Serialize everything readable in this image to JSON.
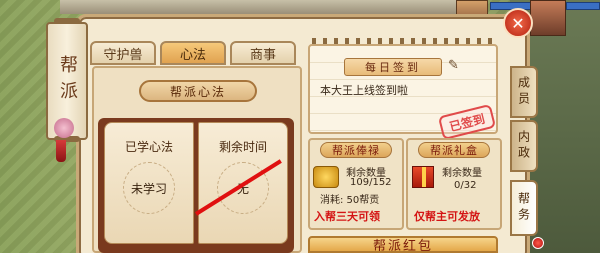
{
  "banner": {
    "label": "帮派"
  },
  "close": {
    "label": "✕"
  },
  "tabs": [
    {
      "label": "守护兽",
      "active": false
    },
    {
      "label": "心法",
      "active": true
    },
    {
      "label": "商事",
      "active": false
    }
  ],
  "left_panel": {
    "title": "帮派心法",
    "learned_label": "已学心法",
    "learned_value": "未学习",
    "time_label": "剩余时间",
    "time_value": "无"
  },
  "daily_signin": {
    "title": "每日签到",
    "motto": "本大王上线签到啦",
    "stamp": "已签到"
  },
  "salary": {
    "title": "帮派俸禄",
    "remain_label": "剩余数量",
    "remain_value": "109/152",
    "cost": "消耗: 50帮贡",
    "note": "入帮三天可领"
  },
  "gift": {
    "title": "帮派礼盒",
    "remain_label": "剩余数量",
    "remain_value": "0/32",
    "note": "仅帮主可发放"
  },
  "bottom_banner": {
    "label": "帮派红包"
  },
  "side_tabs": [
    {
      "label": "成员",
      "active": false
    },
    {
      "label": "内政",
      "active": false
    },
    {
      "label": "帮务",
      "active": true
    }
  ],
  "colors": {
    "accent": "#e0a250",
    "stamp": "#e04a4a",
    "panel": "#f4ead2"
  }
}
